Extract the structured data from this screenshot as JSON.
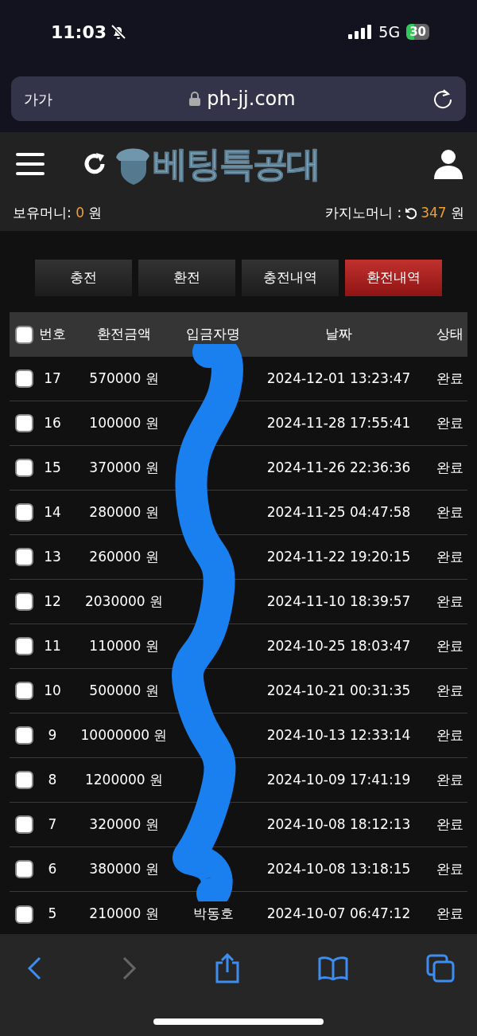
{
  "status_bar": {
    "time": "11:03",
    "network": "5G",
    "battery": "30"
  },
  "browser": {
    "text_size": "가가",
    "url": "ph-jj.com"
  },
  "site": {
    "logo": "베팅특공대",
    "balance_label": "보유머니:",
    "balance_value": "0",
    "balance_unit": "원",
    "casino_label": "카지노머니 :",
    "casino_value": "347",
    "casino_unit": "원"
  },
  "tabs": [
    {
      "label": "충전",
      "selected": false
    },
    {
      "label": "환전",
      "selected": false
    },
    {
      "label": "충전내역",
      "selected": false
    },
    {
      "label": "환전내역",
      "selected": true
    }
  ],
  "table": {
    "select_all_checked": false,
    "columns": [
      "번호",
      "환전금액",
      "입금자명",
      "날짜",
      "상태"
    ],
    "rows": [
      {
        "number": "17",
        "amount": "570000 원",
        "date": "2024-12-01 13:23:47",
        "status": "완료",
        "checked": false
      },
      {
        "number": "16",
        "amount": "100000 원",
        "date": "2024-11-28 17:55:41",
        "status": "완료",
        "checked": false
      },
      {
        "number": "15",
        "amount": "370000 원",
        "date": "2024-11-26 22:36:36",
        "status": "완료",
        "checked": false
      },
      {
        "number": "14",
        "amount": "280000 원",
        "date": "2024-11-25 04:47:58",
        "status": "완료",
        "checked": false
      },
      {
        "number": "13",
        "amount": "260000 원",
        "date": "2024-11-22 19:20:15",
        "status": "완료",
        "checked": false
      },
      {
        "number": "12",
        "amount": "2030000 원",
        "date": "2024-11-10 18:39:57",
        "status": "완료",
        "checked": false
      },
      {
        "number": "11",
        "amount": "110000 원",
        "date": "2024-10-25 18:03:47",
        "status": "완료",
        "checked": false
      },
      {
        "number": "10",
        "amount": "500000 원",
        "date": "2024-10-21 00:31:35",
        "status": "완료",
        "checked": false
      },
      {
        "number": "9",
        "amount": "10000000 원",
        "date": "2024-10-13 12:33:14",
        "status": "완료",
        "checked": false
      },
      {
        "number": "8",
        "amount": "1200000 원",
        "date": "2024-10-09 17:41:19",
        "status": "완료",
        "checked": false
      },
      {
        "number": "7",
        "amount": "320000 원",
        "date": "2024-10-08 18:12:13",
        "status": "완료",
        "checked": false
      },
      {
        "number": "6",
        "amount": "380000 원",
        "date": "2024-10-08 13:18:15",
        "status": "완료",
        "checked": false
      },
      {
        "number": "5",
        "amount": "210000 원",
        "depositor": "박동호",
        "date": "2024-10-07 06:47:12",
        "status": "완료",
        "checked": false
      }
    ]
  }
}
